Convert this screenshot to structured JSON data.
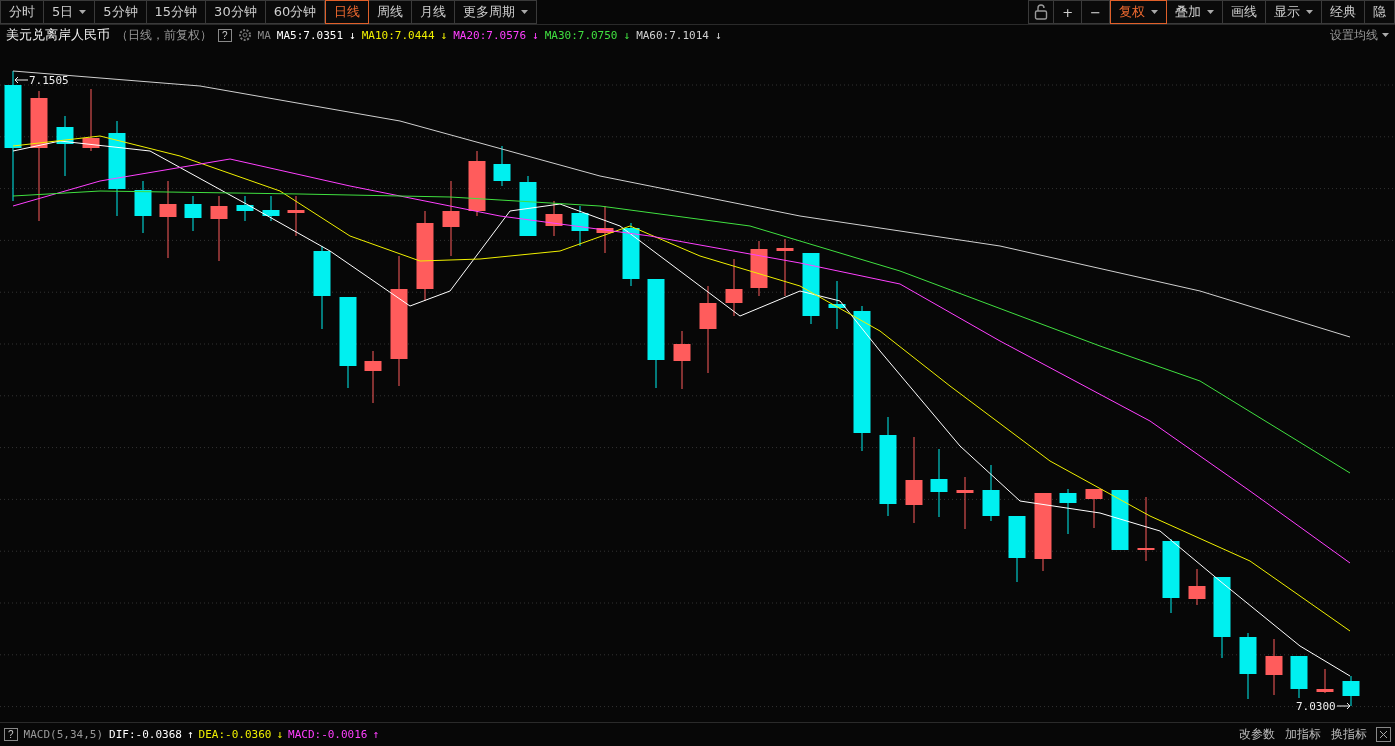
{
  "period_tabs": [
    {
      "label": "分时",
      "selected": false,
      "has_menu": false
    },
    {
      "label": "5日",
      "selected": false,
      "has_menu": true
    },
    {
      "label": "5分钟",
      "selected": false,
      "has_menu": false
    },
    {
      "label": "15分钟",
      "selected": false,
      "has_menu": false
    },
    {
      "label": "30分钟",
      "selected": false,
      "has_menu": false
    },
    {
      "label": "60分钟",
      "selected": false,
      "has_menu": false
    },
    {
      "label": "日线",
      "selected": true,
      "has_menu": false
    },
    {
      "label": "周线",
      "selected": false,
      "has_menu": false
    },
    {
      "label": "月线",
      "selected": false,
      "has_menu": false
    },
    {
      "label": "更多周期",
      "selected": false,
      "has_menu": true
    }
  ],
  "tools": [
    {
      "label": "+",
      "selected": false,
      "has_menu": false
    },
    {
      "label": "−",
      "selected": false,
      "has_menu": false
    },
    {
      "label": "复权",
      "selected": true,
      "has_menu": true
    },
    {
      "label": "叠加",
      "selected": false,
      "has_menu": true
    },
    {
      "label": "画线",
      "selected": false,
      "has_menu": false
    },
    {
      "label": "显示",
      "selected": false,
      "has_menu": true
    },
    {
      "label": "经典",
      "selected": false,
      "has_menu": false
    },
    {
      "label": "隐",
      "selected": false,
      "has_menu": false
    }
  ],
  "legend": {
    "title": "美元兑离岸人民币",
    "subtitle": "（日线，前复权）",
    "help": "?",
    "ma_label": "MA",
    "settings": "设置均线",
    "lines": [
      {
        "text": "MA5:7.0351",
        "arrow": "↓",
        "color": "#ffffff"
      },
      {
        "text": "MA10:7.0444",
        "arrow": "↓",
        "color": "#f0f000"
      },
      {
        "text": "MA20:7.0576",
        "arrow": "↓",
        "color": "#ff40ff"
      },
      {
        "text": "MA30:7.0750",
        "arrow": "↓",
        "color": "#40e040"
      },
      {
        "text": "MA60:7.1014",
        "arrow": "↓",
        "color": "#d0d0d0"
      }
    ]
  },
  "chart": {
    "high_label": "7.1505",
    "low_label": "7.0300"
  },
  "indicator": {
    "help": "?",
    "name": "MACD(5,34,5)",
    "values": [
      {
        "text": "DIF:-0.0368",
        "arrow": "↑",
        "color": "#ffffff"
      },
      {
        "text": "DEA:-0.0360",
        "arrow": "↓",
        "color": "#f0f000"
      },
      {
        "text": "MACD:-0.0016",
        "arrow": "↑",
        "color": "#ff40ff"
      }
    ],
    "actions": [
      "改参数",
      "加指标",
      "换指标"
    ]
  }
}
